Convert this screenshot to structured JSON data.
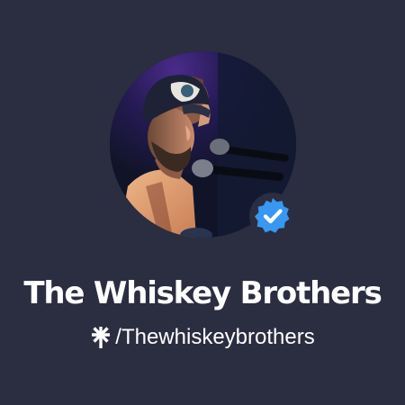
{
  "profile": {
    "display_name": "The Whiskey Brothers",
    "handle_prefix_icon": "linktree-icon",
    "handle": "/Thewhiskeybrothers",
    "avatar_icon": "band-photo",
    "verified_icon": "verified-badge-icon"
  },
  "colors": {
    "background": "#2b2d40",
    "text": "#ffffff",
    "verified": "#3897f0"
  }
}
